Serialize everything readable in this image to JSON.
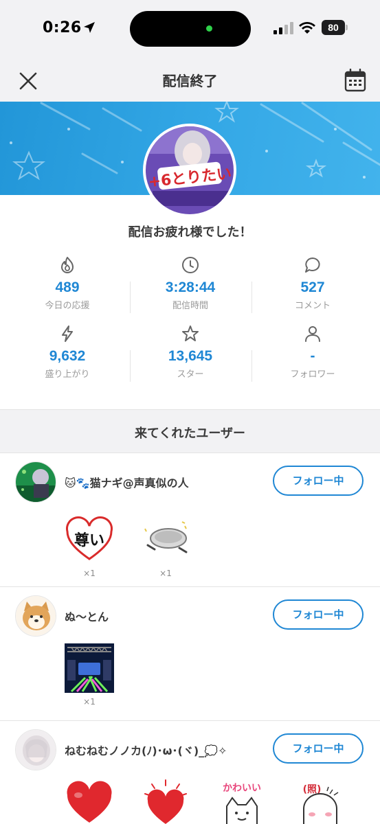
{
  "status_bar": {
    "time": "0:26",
    "battery": "80"
  },
  "header": {
    "title": "配信終了"
  },
  "summary": {
    "message": "配信お疲れ様でした！",
    "avatar_text": "+6とりたい",
    "stats": [
      {
        "icon": "flame-icon",
        "value": "489",
        "label": "今日の応援"
      },
      {
        "icon": "clock-icon",
        "value": "3:28:44",
        "label": "配信時間"
      },
      {
        "icon": "comment-icon",
        "value": "527",
        "label": "コメント"
      },
      {
        "icon": "lightning-icon",
        "value": "9,632",
        "label": "盛り上がり"
      },
      {
        "icon": "star-icon",
        "value": "13,645",
        "label": "スター"
      },
      {
        "icon": "person-icon",
        "value": "-",
        "label": "フォロワー"
      }
    ]
  },
  "visitors": {
    "title": "来てくれたユーザー",
    "users": [
      {
        "name": "🐱🐾猫ナギ@声真似の人",
        "follow_label": "フォロー中",
        "gifts": [
          {
            "name": "heart-frame-sticker",
            "text": "尊い",
            "count": "×1"
          },
          {
            "name": "pan-sticker",
            "count": "×1"
          }
        ]
      },
      {
        "name": "ぬ〜とん",
        "follow_label": "フォロー中",
        "gifts": [
          {
            "name": "concert-stage-sticker",
            "count": "×1"
          }
        ]
      },
      {
        "name": "ねむねむノノカ(ﾉ)･ω･(ヾ)_💭✧",
        "follow_label": "フォロー中",
        "gifts": [
          {
            "name": "red-heart-sticker"
          },
          {
            "name": "sparkle-heart-sticker"
          },
          {
            "name": "kawaii-cat-sticker",
            "text": "かわいい"
          },
          {
            "name": "shy-ghost-sticker",
            "text": "(照)"
          }
        ]
      }
    ]
  },
  "colors": {
    "accent": "#1f87d4",
    "banner": "#2a9de0",
    "header_bg": "#f2f2f4"
  }
}
